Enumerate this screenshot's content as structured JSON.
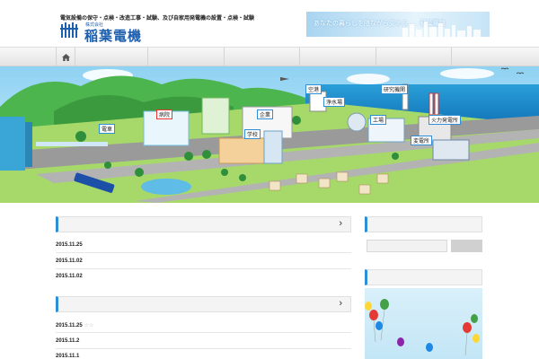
{
  "header": {
    "tagline": "電気設備の保守・点検・改造工事・試験、及び自家用発電機の設置・点検・試験",
    "logo_small": "株式会社",
    "logo_name": "稲葉電機",
    "banner_text": "あなたの暮らしを陰ながら支える．．．稲葉電機"
  },
  "nav": {
    "home_icon": "home-icon"
  },
  "hero": {
    "labels": {
      "hospital": "病院",
      "company": "企業",
      "school": "学校",
      "train": "電車",
      "airport": "空港",
      "water_plant": "浄水場",
      "research": "研究機関",
      "factory": "工場",
      "thermal_plant": "火力発電所",
      "substation": "変電所"
    }
  },
  "news_section_1": {
    "items": [
      {
        "date": "2015.11.25"
      },
      {
        "date": "2015.11.02"
      },
      {
        "date": "2015.11.02"
      }
    ]
  },
  "news_section_2": {
    "items": [
      {
        "date": "2015.11.25",
        "stars": "☆☆"
      },
      {
        "date": "2015.11.2"
      },
      {
        "date": "2015.11.1"
      }
    ]
  },
  "sidebar": {
    "search_placeholder": "",
    "search_button": ""
  },
  "colors": {
    "accent": "#2e8fd6",
    "brand": "#1a5fb0"
  }
}
